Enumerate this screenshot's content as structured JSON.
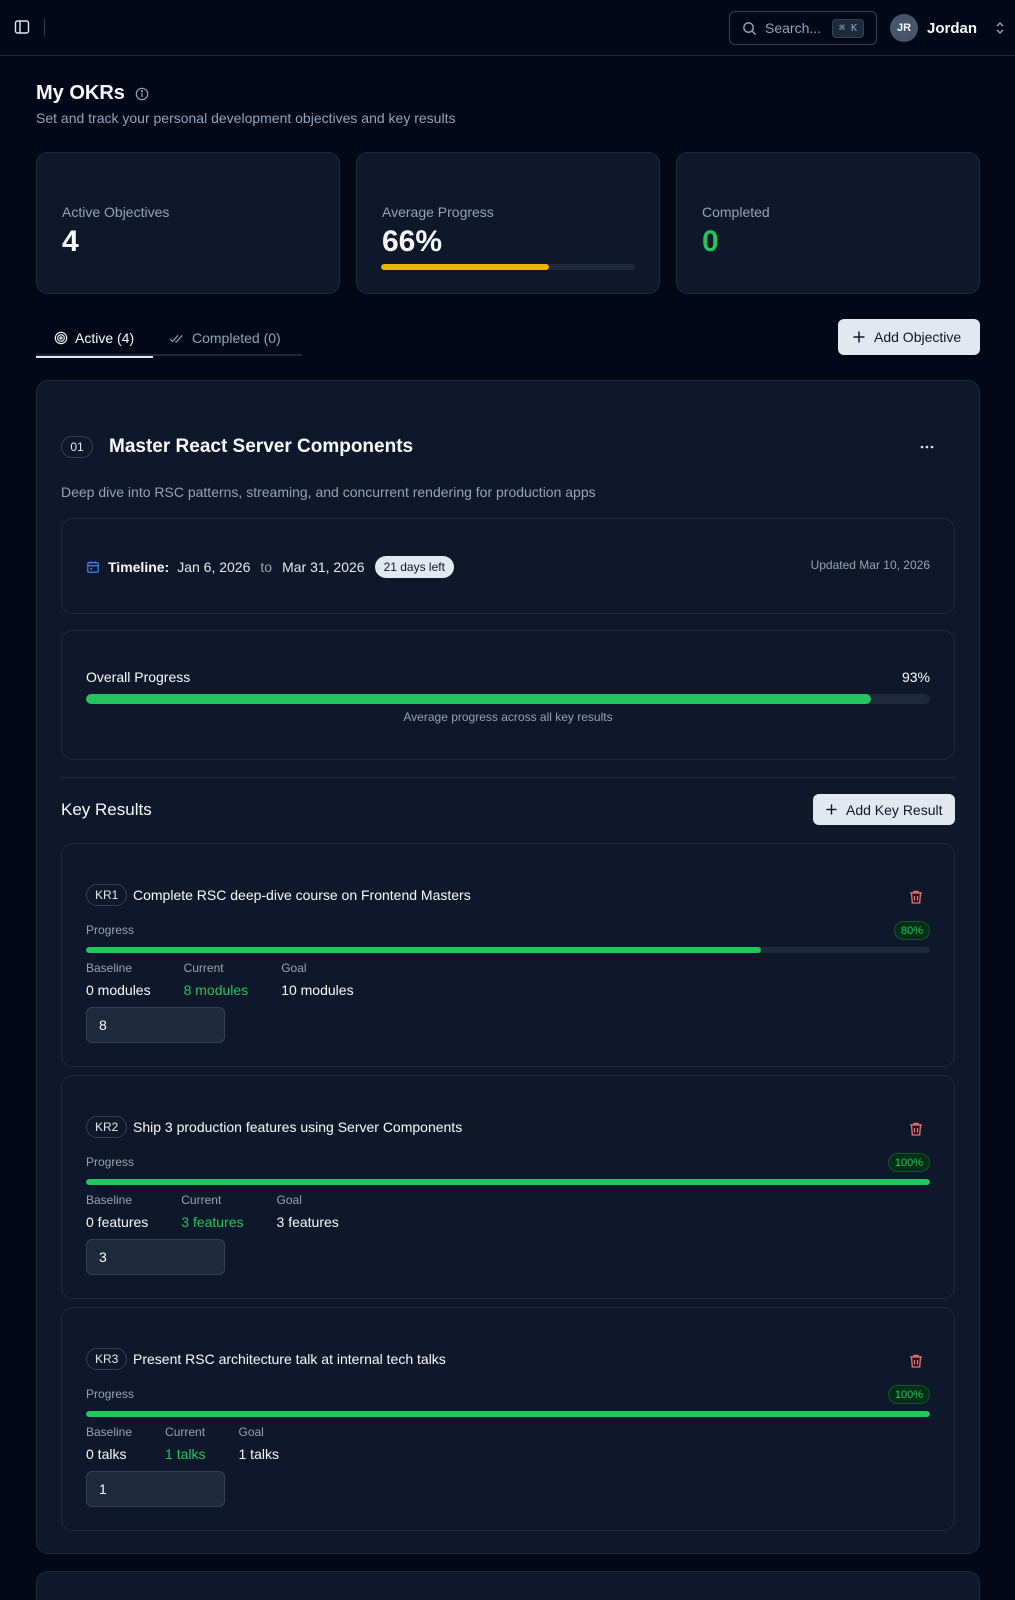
{
  "topbar": {
    "search_placeholder": "Search...",
    "search_shortcut": "⌘ K",
    "user_initials": "JR",
    "user_name": "Jordan"
  },
  "header": {
    "title": "My OKRs",
    "subtitle": "Set and track your personal development objectives and key results"
  },
  "stats": {
    "active_objectives": {
      "label": "Active Objectives",
      "value": "4"
    },
    "average_progress": {
      "label": "Average Progress",
      "value": "66%",
      "progress_fraction": 0.66
    },
    "completed": {
      "label": "Completed",
      "value": "0"
    }
  },
  "tabs": [
    {
      "label": "Active (4)",
      "active": true
    },
    {
      "label": "Completed (0)",
      "active": false
    }
  ],
  "add_objective_label": "Add Objective",
  "objective": {
    "number": "01",
    "title": "Master React Server Components",
    "description": "Deep dive into RSC patterns, streaming, and concurrent rendering for production apps",
    "timeline_label": "Timeline:",
    "start_date": "Jan 6, 2026",
    "to_word": "to",
    "end_date": "Mar 31, 2026",
    "days_left": "21 days left",
    "updated": "Updated Mar 10, 2026",
    "overall_progress_label": "Overall Progress",
    "overall_progress_value": "93%",
    "overall_progress_fraction": 0.93,
    "overall_progress_caption": "Average progress across all key results",
    "key_results_heading": "Key Results",
    "add_key_result_label": "Add Key Result",
    "key_results": [
      {
        "badge": "KR1",
        "title": "Complete RSC deep-dive course on Frontend Masters",
        "progress_label": "Progress",
        "percent": "80%",
        "fraction": 0.8,
        "baseline_label": "Baseline",
        "baseline": "0 modules",
        "current_label": "Current",
        "current": "8 modules",
        "goal_label": "Goal",
        "goal": "10 modules",
        "input_value": "8"
      },
      {
        "badge": "KR2",
        "title": "Ship 3 production features using Server Components",
        "progress_label": "Progress",
        "percent": "100%",
        "fraction": 1.0,
        "baseline_label": "Baseline",
        "baseline": "0 features",
        "current_label": "Current",
        "current": "3 features",
        "goal_label": "Goal",
        "goal": "3 features",
        "input_value": "3"
      },
      {
        "badge": "KR3",
        "title": "Present RSC architecture talk at internal tech talks",
        "progress_label": "Progress",
        "percent": "100%",
        "fraction": 1.0,
        "baseline_label": "Baseline",
        "baseline": "0 talks",
        "current_label": "Current",
        "current": "1 talks",
        "goal_label": "Goal",
        "goal": "1 talks",
        "input_value": "1"
      }
    ]
  },
  "colors": {
    "background": "#020817",
    "card": "#0f172a",
    "border": "#1e293b",
    "success": "#22c55e",
    "warning": "#eab308",
    "muted_text": "#94a3b8"
  },
  "icons": {
    "sidebar_toggle": "panel-left-icon",
    "search": "search-icon",
    "user_menu": "chevrons-up-down-icon",
    "info": "info-icon",
    "active_tab": "target-icon",
    "completed_tab": "check-check-icon",
    "add": "plus-icon",
    "menu": "more-horizontal-icon",
    "calendar": "calendar-icon",
    "delete": "trash-icon"
  }
}
